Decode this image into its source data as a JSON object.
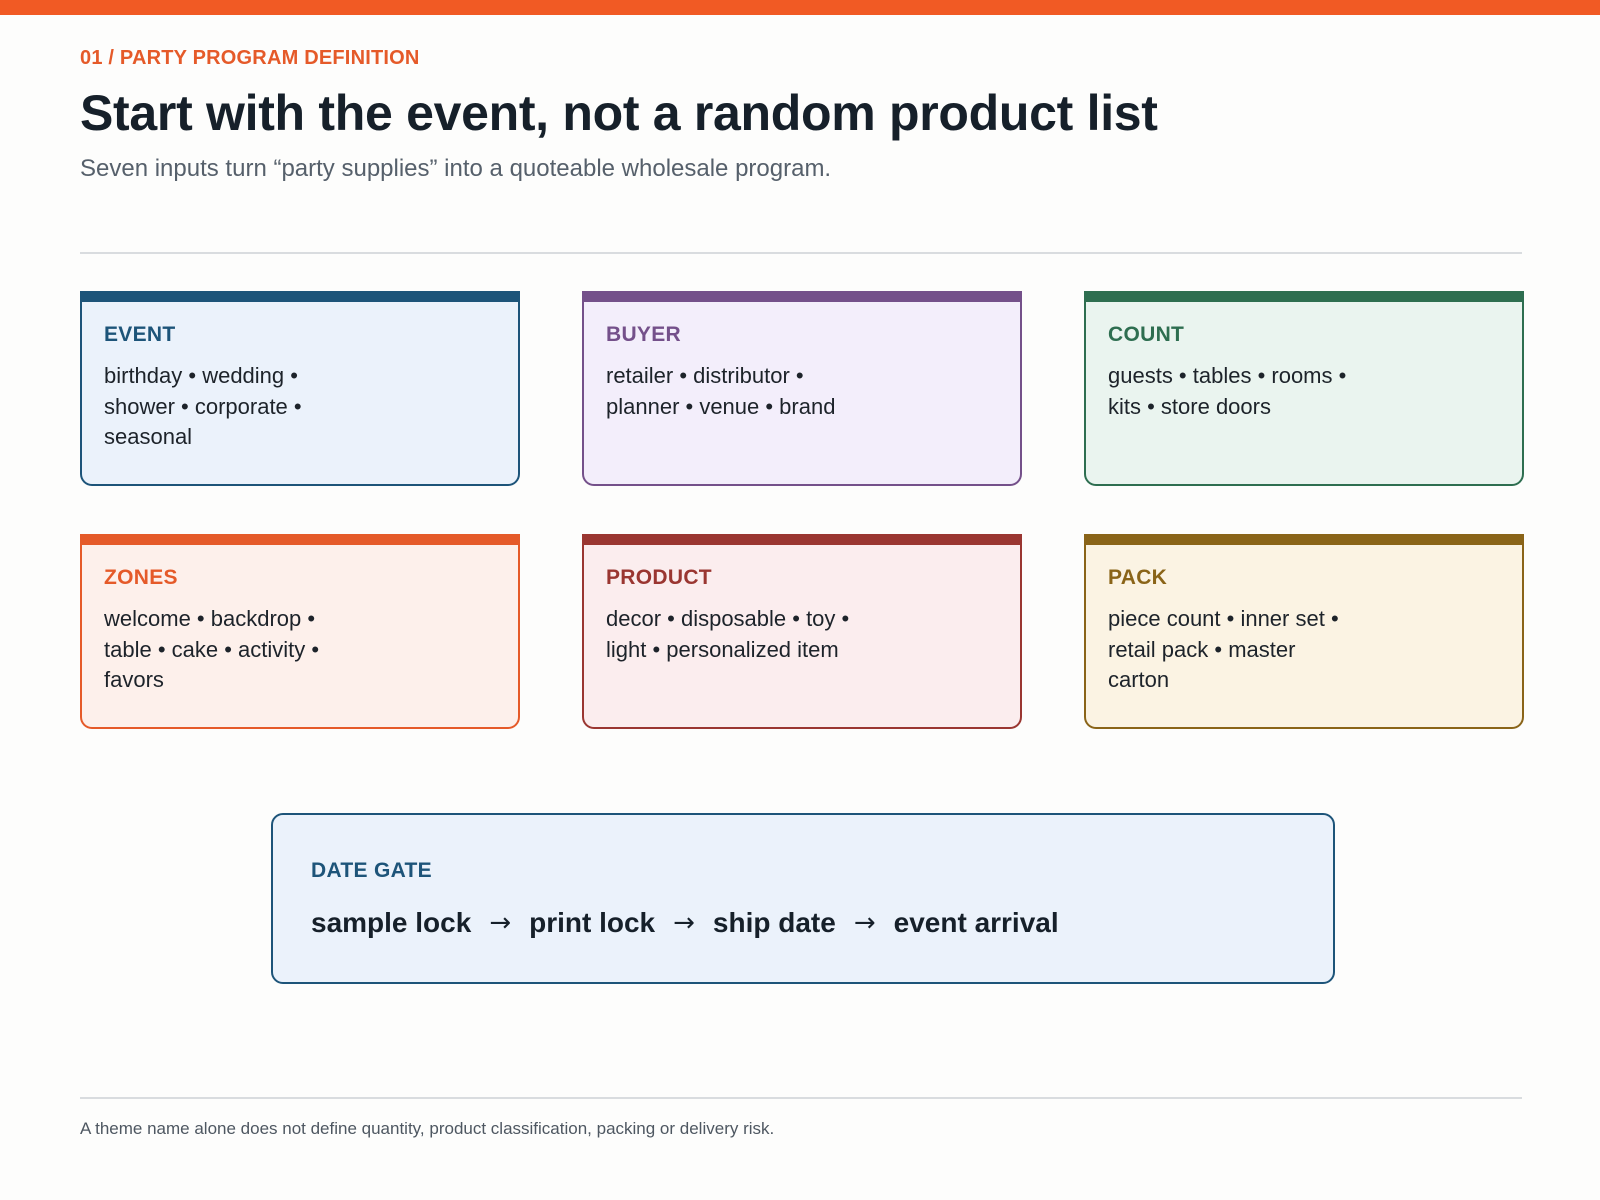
{
  "header": {
    "eyebrow": "01 / PARTY PROGRAM DEFINITION",
    "title": "Start with the event, not a random product list",
    "subtitle": "Seven inputs turn “party supplies” into a quoteable wholesale program."
  },
  "cards": [
    {
      "label": "EVENT",
      "text": "birthday • wedding • shower • corporate • seasonal",
      "accent": "#1d5479",
      "fill": "#ebf2fb"
    },
    {
      "label": "BUYER",
      "text": "retailer • distributor • planner • venue • brand",
      "accent": "#74508a",
      "fill": "#f3eefb"
    },
    {
      "label": "COUNT",
      "text": "guests • tables • rooms • kits • store doors",
      "accent": "#2e6e50",
      "fill": "#eaf4ef"
    },
    {
      "label": "ZONES",
      "text": "welcome • backdrop • table • cake • activity • favors",
      "accent": "#e55a29",
      "fill": "#fdf0eb"
    },
    {
      "label": "PRODUCT",
      "text": "decor • disposable • toy • light • personalized item",
      "accent": "#9a3631",
      "fill": "#fbedee"
    },
    {
      "label": "PACK",
      "text": "piece count • inner set • retail pack • master carton",
      "accent": "#8a6418",
      "fill": "#fbf3e3"
    }
  ],
  "date_gate": {
    "label": "DATE GATE",
    "steps": [
      "sample lock",
      "print lock",
      "ship date",
      "event arrival"
    ],
    "arrow": "→"
  },
  "footnote": "A theme name alone does not define quantity, product classification, packing or delivery risk."
}
